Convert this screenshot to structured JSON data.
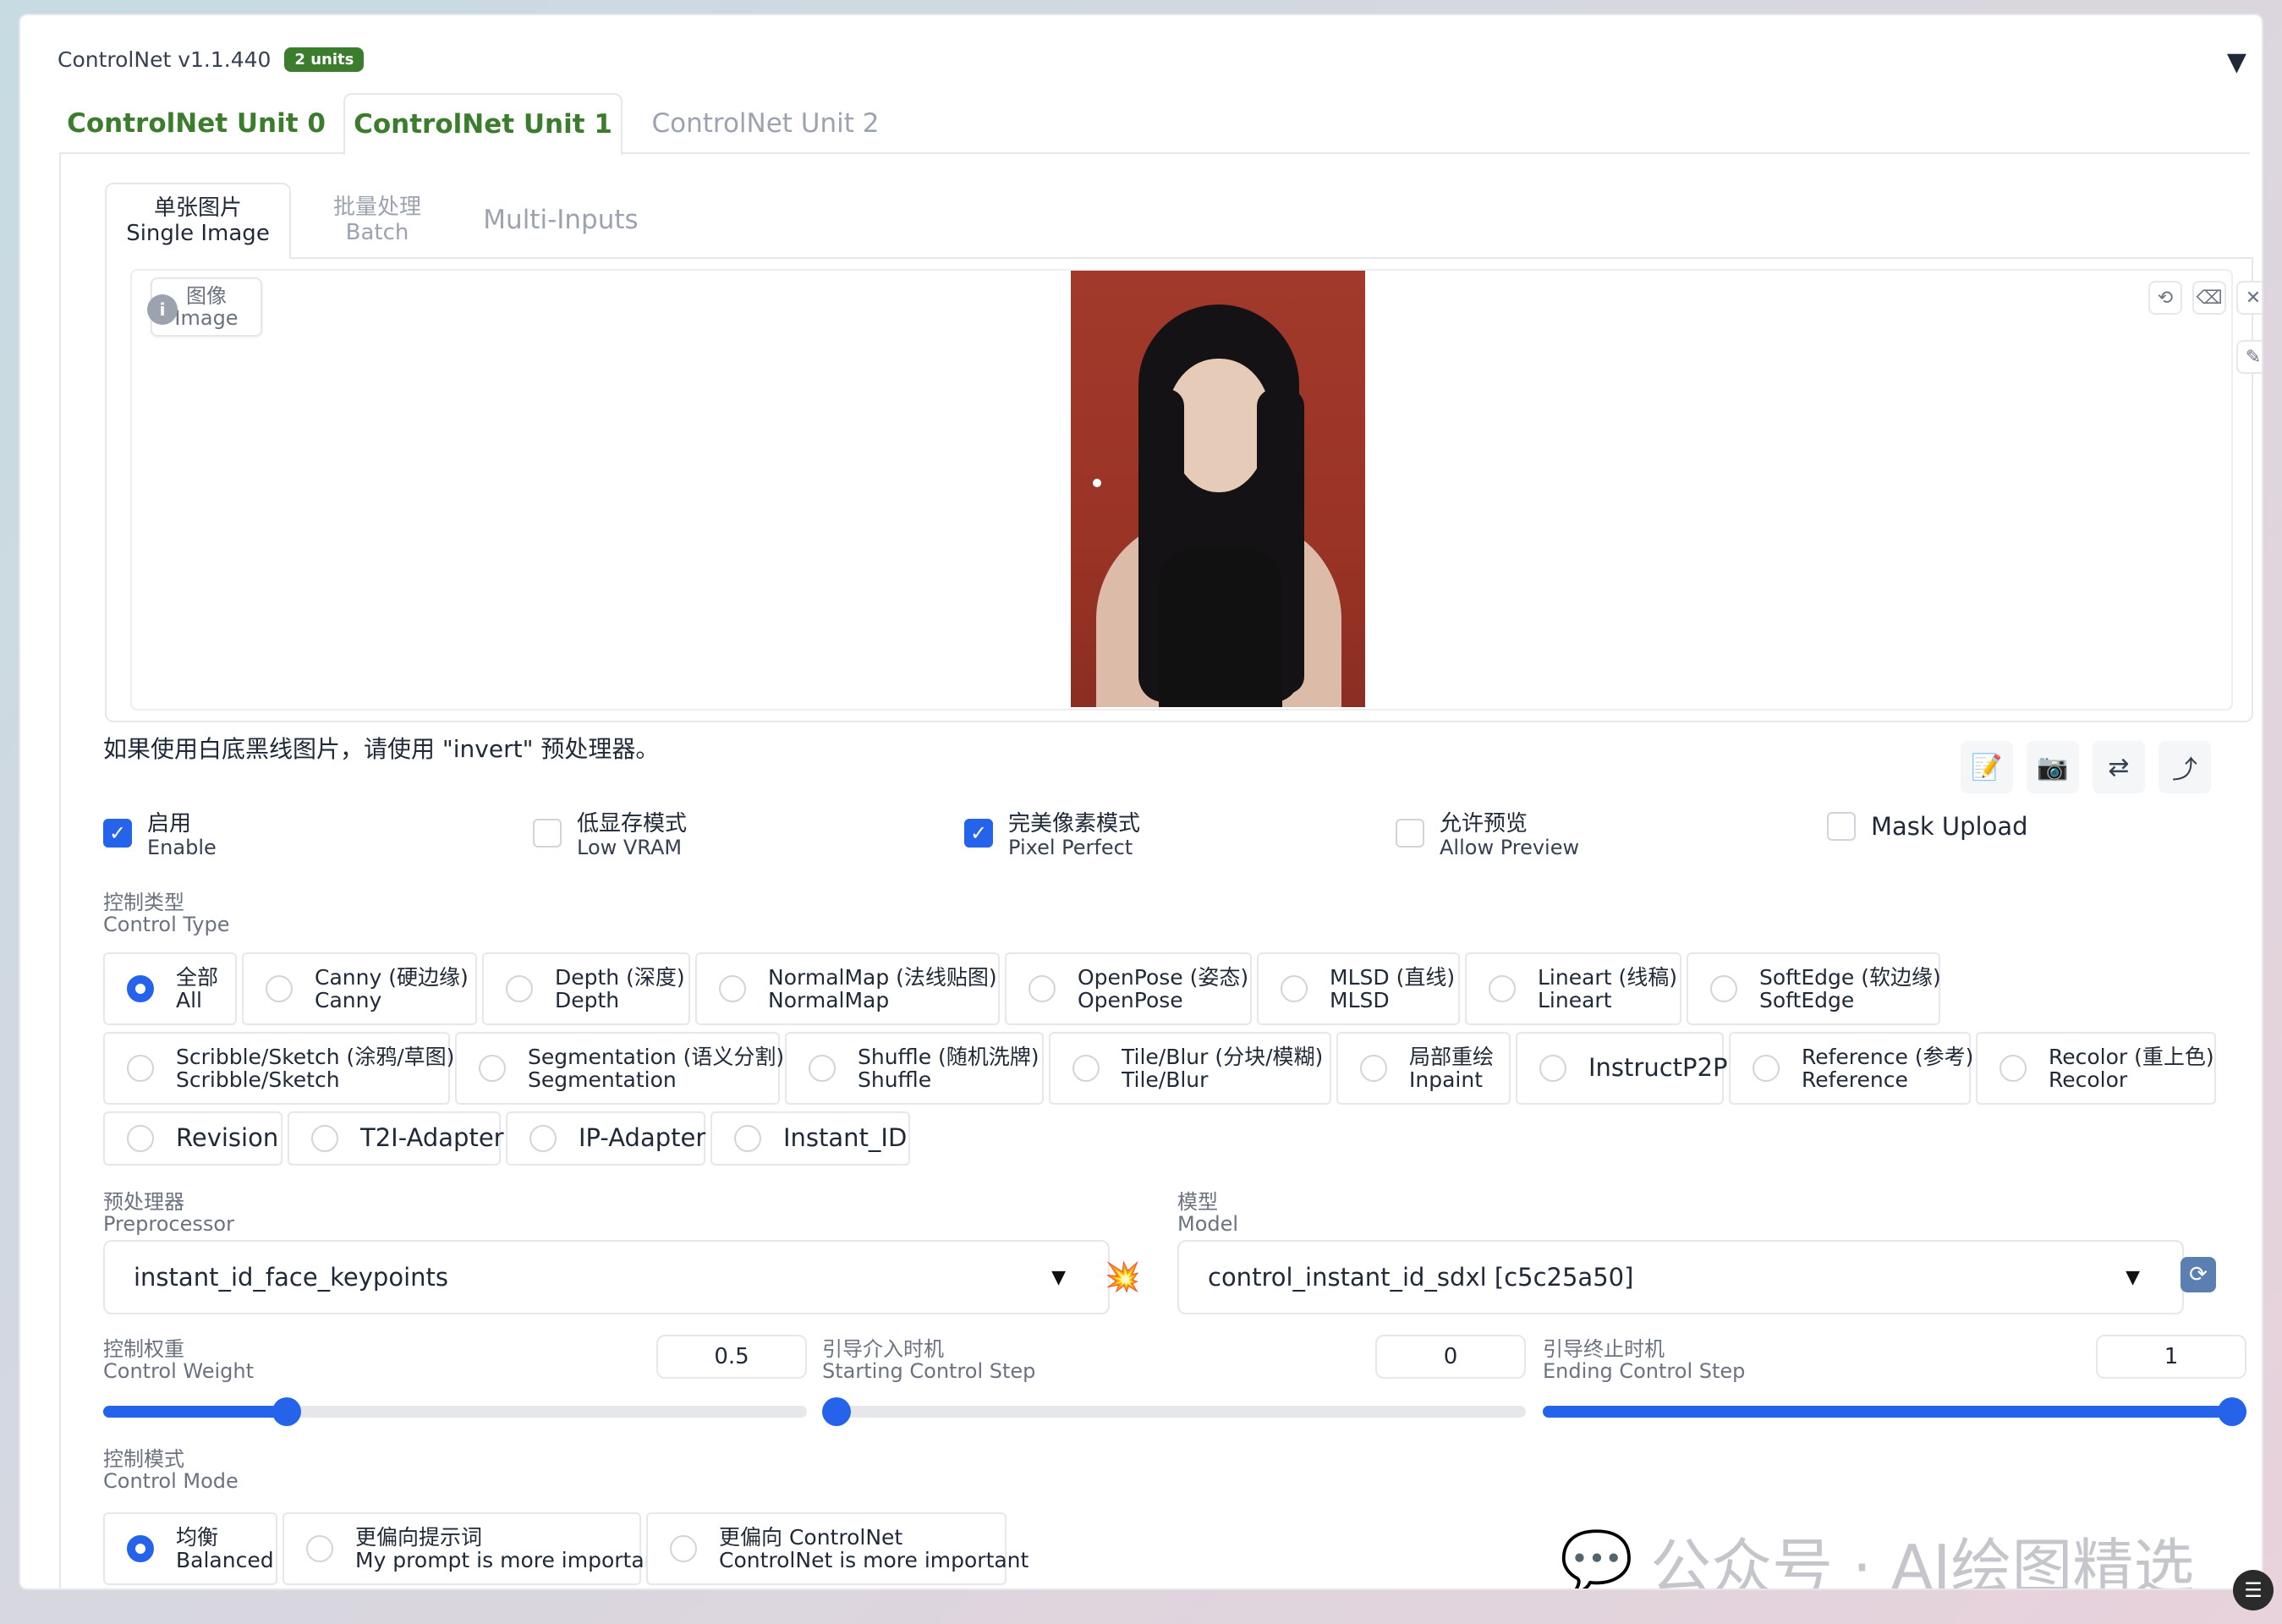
{
  "header": {
    "title": "ControlNet v1.1.440",
    "badge": "2 units",
    "collapse_icon": "triangle-down-icon"
  },
  "unit_tabs": [
    {
      "label": "ControlNet Unit 0"
    },
    {
      "label": "ControlNet Unit 1"
    },
    {
      "label": "ControlNet Unit 2"
    }
  ],
  "input_tabs": {
    "single": {
      "cn": "单张图片",
      "en": "Single Image"
    },
    "batch": {
      "cn": "批量处理",
      "en": "Batch"
    },
    "multi": {
      "label": "Multi-Inputs"
    }
  },
  "image_label": {
    "cn": "图像",
    "en": "Image",
    "icon": "image-icon"
  },
  "image_tools": [
    "undo-icon",
    "eraser-icon",
    "close-icon",
    "brush-icon"
  ],
  "hint": "如果使用白底黑线图片，请使用 \"invert\" 预处理器。",
  "toolbar_icons": [
    "edit-icon",
    "camera-icon",
    "swap-icon",
    "upload-arrow-icon"
  ],
  "checkboxes": {
    "enable": {
      "cn": "启用",
      "en": "Enable",
      "checked": true
    },
    "low_vram": {
      "cn": "低显存模式",
      "en": "Low VRAM",
      "checked": false
    },
    "pixel_perfect": {
      "cn": "完美像素模式",
      "en": "Pixel Perfect",
      "checked": true
    },
    "allow_preview": {
      "cn": "允许预览",
      "en": "Allow Preview",
      "checked": false
    },
    "mask_upload": {
      "label": "Mask Upload",
      "checked": false
    }
  },
  "control_type": {
    "label_cn": "控制类型",
    "label_en": "Control Type",
    "row1": [
      {
        "cn": "全部",
        "en": "All",
        "selected": true
      },
      {
        "cn": "Canny (硬边缘)",
        "en": "Canny"
      },
      {
        "cn": "Depth (深度)",
        "en": "Depth"
      },
      {
        "cn": "NormalMap (法线贴图)",
        "en": "NormalMap"
      },
      {
        "cn": "OpenPose (姿态)",
        "en": "OpenPose"
      },
      {
        "cn": "MLSD (直线)",
        "en": "MLSD"
      },
      {
        "cn": "Lineart (线稿)",
        "en": "Lineart"
      },
      {
        "cn": "SoftEdge (软边缘)",
        "en": "SoftEdge"
      }
    ],
    "row2": [
      {
        "cn": "Scribble/Sketch (涂鸦/草图)",
        "en": "Scribble/Sketch"
      },
      {
        "cn": "Segmentation (语义分割)",
        "en": "Segmentation"
      },
      {
        "cn": "Shuffle (随机洗牌)",
        "en": "Shuffle"
      },
      {
        "cn": "Tile/Blur (分块/模糊)",
        "en": "Tile/Blur"
      },
      {
        "cn": "局部重绘",
        "en": "Inpaint"
      },
      {
        "single": "InstructP2P"
      },
      {
        "cn": "Reference (参考)",
        "en": "Reference"
      },
      {
        "cn": "Recolor (重上色)",
        "en": "Recolor"
      }
    ],
    "row3": [
      {
        "single": "Revision"
      },
      {
        "single": "T2I-Adapter"
      },
      {
        "single": "IP-Adapter"
      },
      {
        "single": "Instant_ID"
      }
    ]
  },
  "preprocessor": {
    "label_cn": "预处理器",
    "label_en": "Preprocessor",
    "value": "instant_id_face_keypoints"
  },
  "model": {
    "label_cn": "模型",
    "label_en": "Model",
    "value": "control_instant_id_sdxl [c5c25a50]"
  },
  "sliders": {
    "weight": {
      "label_cn": "控制权重",
      "label_en": "Control Weight",
      "value": "0.5",
      "min": 0,
      "max": 2
    },
    "start": {
      "label_cn": "引导介入时机",
      "label_en": "Starting Control Step",
      "value": "0",
      "min": 0,
      "max": 1
    },
    "end": {
      "label_cn": "引导终止时机",
      "label_en": "Ending Control Step",
      "value": "1",
      "min": 0,
      "max": 1
    }
  },
  "control_mode": {
    "label_cn": "控制模式",
    "label_en": "Control Mode",
    "options": [
      {
        "cn": "均衡",
        "en": "Balanced",
        "selected": true
      },
      {
        "cn": "更偏向提示词",
        "en": "My prompt is more important"
      },
      {
        "cn": "更偏向 ControlNet",
        "en": "ControlNet is more important"
      }
    ]
  },
  "watermark": {
    "text": "公众号 · AI绘图精选",
    "icon": "wechat-icon"
  },
  "colors": {
    "accent": "#2563eb",
    "brand_green": "#3b7d2d",
    "border": "#e5e7eb"
  }
}
